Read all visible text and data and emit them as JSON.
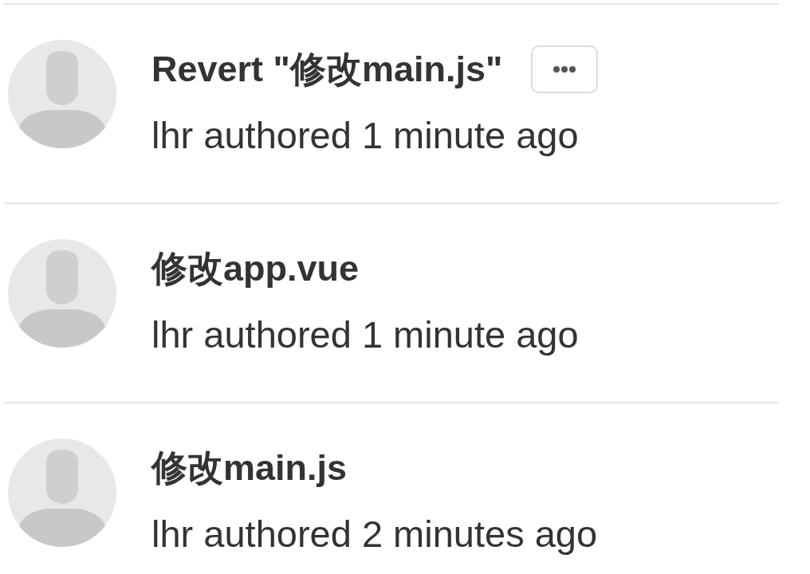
{
  "commits": [
    {
      "title": "Revert \"修改main.js\"",
      "meta": "lhr authored 1 minute ago",
      "menu_button": true
    },
    {
      "title": "修改app.vue",
      "meta": "lhr authored 1 minute ago",
      "menu_button": false
    },
    {
      "title": "修改main.js",
      "meta": "lhr authored 2 minutes ago",
      "menu_button": false
    }
  ]
}
